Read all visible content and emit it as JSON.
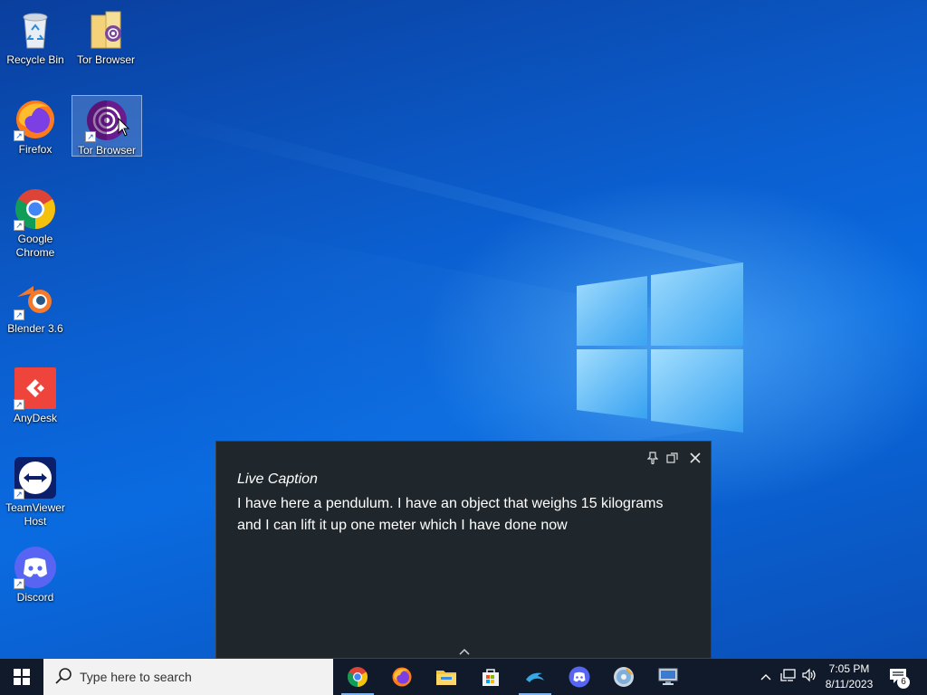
{
  "desktop_icons": [
    {
      "label": "Recycle Bin",
      "icon": "recycle-bin-icon"
    },
    {
      "label": "Tor Browser",
      "icon": "tor-folder-icon"
    },
    {
      "label": "Firefox",
      "icon": "firefox-icon"
    },
    {
      "label": "Tor Browser",
      "icon": "tor-browser-icon"
    },
    {
      "label": "Google Chrome",
      "icon": "chrome-icon"
    },
    {
      "label": "Blender 3.6",
      "icon": "blender-icon"
    },
    {
      "label": "AnyDesk",
      "icon": "anydesk-icon"
    },
    {
      "label": "TeamViewer Host",
      "icon": "teamviewer-icon"
    },
    {
      "label": "Discord",
      "icon": "discord-icon"
    }
  ],
  "caption": {
    "title": "Live Caption",
    "text": "I have here a pendulum. I have an object that weighs 15 kilograms and I can lift it up one meter which I have done now",
    "controls": [
      "pin-icon",
      "restore-icon",
      "close-icon"
    ]
  },
  "taskbar": {
    "search_placeholder": "Type here to search",
    "apps": [
      "chrome-icon",
      "firefox-icon",
      "file-explorer-icon",
      "microsoft-store-icon",
      "dolphin-icon",
      "discord-icon",
      "media-disc-icon",
      "remote-desktop-icon"
    ]
  },
  "tray": {
    "time": "7:05 PM",
    "date": "8/11/2023",
    "notification_count": "6"
  },
  "colors": {
    "accent": "#0a6be0",
    "taskbar": "#101a2a",
    "caption_bg": "#1f272c"
  }
}
